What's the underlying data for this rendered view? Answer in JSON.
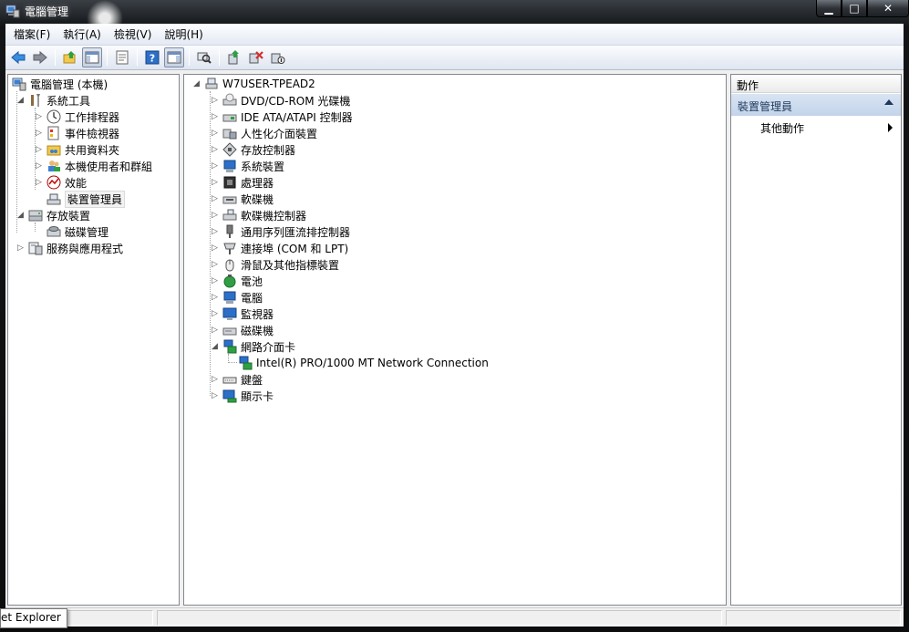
{
  "window": {
    "title": "電腦管理",
    "minimize": "▁",
    "maximize": "□",
    "close": "✕"
  },
  "menu": [
    "檔案(F)",
    "執行(A)",
    "檢視(V)",
    "說明(H)"
  ],
  "toolbar": [
    "back-icon",
    "forward-icon",
    "up-folder-icon",
    "show-hide-tree-icon",
    "properties-icon",
    "help-icon",
    "show-hide-action-pane-icon",
    "scan-hardware-icon",
    "update-driver-icon",
    "uninstall-icon",
    "disable-icon"
  ],
  "left_tree": {
    "root": "電腦管理 (本機)",
    "items": [
      {
        "label": "系統工具",
        "level": 1,
        "expanded": true
      },
      {
        "label": "工作排程器",
        "level": 2
      },
      {
        "label": "事件檢視器",
        "level": 2
      },
      {
        "label": "共用資料夾",
        "level": 2
      },
      {
        "label": "本機使用者和群組",
        "level": 2
      },
      {
        "label": "效能",
        "level": 2
      },
      {
        "label": "裝置管理員",
        "level": 2,
        "selected": true
      },
      {
        "label": "存放裝置",
        "level": 1,
        "expanded": true
      },
      {
        "label": "磁碟管理",
        "level": 2
      },
      {
        "label": "服務與應用程式",
        "level": 1
      }
    ]
  },
  "device_tree": {
    "root": "W7USER-TPEAD2",
    "items": [
      {
        "label": "DVD/CD-ROM 光碟機"
      },
      {
        "label": "IDE ATA/ATAPI 控制器"
      },
      {
        "label": "人性化介面裝置"
      },
      {
        "label": "存放控制器"
      },
      {
        "label": "系統裝置"
      },
      {
        "label": "處理器"
      },
      {
        "label": "軟碟機"
      },
      {
        "label": "軟碟機控制器"
      },
      {
        "label": "通用序列匯流排控制器"
      },
      {
        "label": "連接埠 (COM 和 LPT)"
      },
      {
        "label": "滑鼠及其他指標裝置"
      },
      {
        "label": "電池"
      },
      {
        "label": "電腦"
      },
      {
        "label": "監視器"
      },
      {
        "label": "磁碟機"
      },
      {
        "label": "網路介面卡",
        "expanded": true
      },
      {
        "label": "Intel(R) PRO/1000 MT Network Connection",
        "child": true
      },
      {
        "label": "鍵盤"
      },
      {
        "label": "顯示卡"
      }
    ]
  },
  "actions": {
    "header": "動作",
    "section": "裝置管理員",
    "item": "其他動作"
  },
  "tooltip": "et Explorer"
}
